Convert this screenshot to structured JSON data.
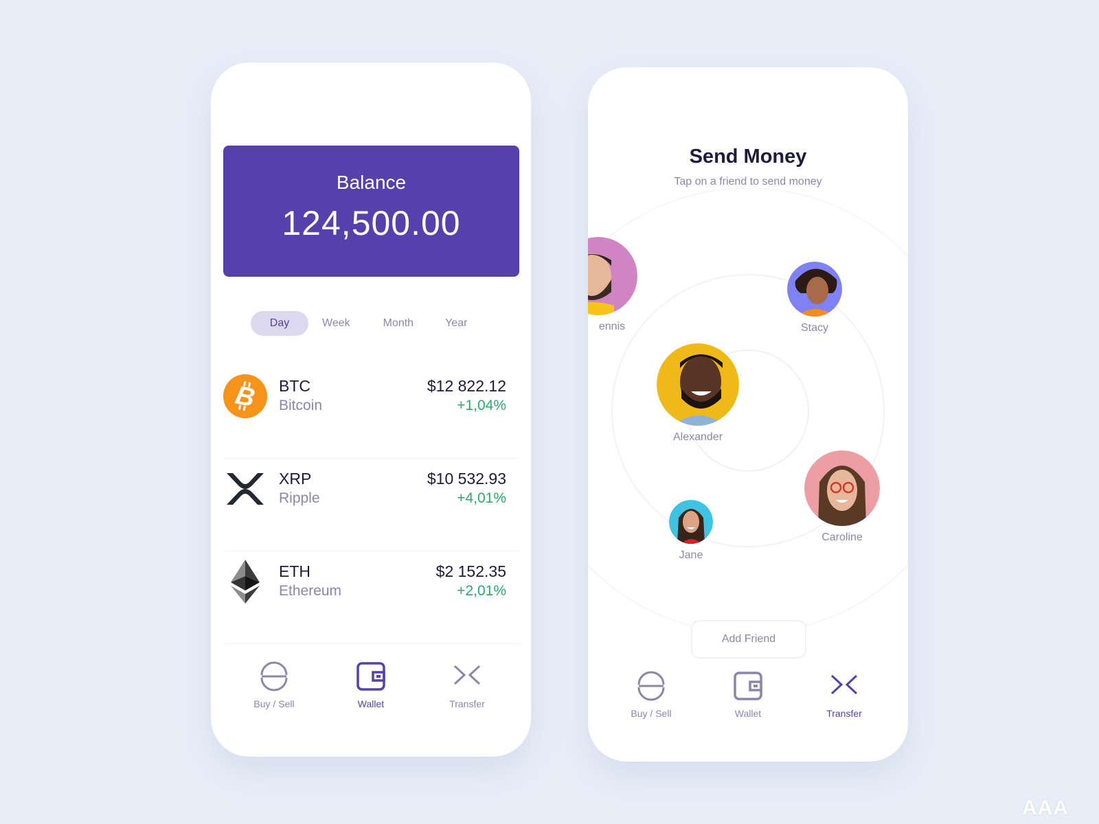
{
  "colors": {
    "background": "#e8eef8",
    "accent": "#5641ac",
    "accent_light": "#dcd9ee",
    "muted_text": "#8b87a8",
    "dark_text": "#1d1b3a",
    "positive": "#2fa86b",
    "btc_orange": "#f7931a"
  },
  "wallet_screen": {
    "balance": {
      "label": "Balance",
      "value": "124,500.00"
    },
    "period_tabs": [
      {
        "label": "Day",
        "active": true
      },
      {
        "label": "Week",
        "active": false
      },
      {
        "label": "Month",
        "active": false
      },
      {
        "label": "Year",
        "active": false
      }
    ],
    "coins": [
      {
        "symbol": "BTC",
        "name": "Bitcoin",
        "price": "$12 822.12",
        "change": "+1,04%",
        "icon": "bitcoin-icon"
      },
      {
        "symbol": "XRP",
        "name": "Ripple",
        "price": "$10 532.93",
        "change": "+4,01%",
        "icon": "ripple-icon"
      },
      {
        "symbol": "ETH",
        "name": "Ethereum",
        "price": "$2 152.35",
        "change": "+2,01%",
        "icon": "ethereum-icon"
      }
    ],
    "nav": [
      {
        "label": "Buy / Sell",
        "icon": "buy-sell-icon",
        "active": false
      },
      {
        "label": "Wallet",
        "icon": "wallet-icon",
        "active": true
      },
      {
        "label": "Transfer",
        "icon": "transfer-icon",
        "active": false
      }
    ]
  },
  "send_screen": {
    "title": "Send Money",
    "subtitle": "Tap on a friend to send money",
    "friends": [
      {
        "name": "ennis",
        "bg": "#d184c4"
      },
      {
        "name": "Stacy",
        "bg": "#7f82f5"
      },
      {
        "name": "Alexander",
        "bg": "#efba19"
      },
      {
        "name": "Caroline",
        "bg": "#ec9ea3"
      },
      {
        "name": "Jane",
        "bg": "#3fc3e3"
      }
    ],
    "add_friend_label": "Add Friend",
    "nav": [
      {
        "label": "Buy / Sell",
        "icon": "buy-sell-icon",
        "active": false
      },
      {
        "label": "Wallet",
        "icon": "wallet-icon",
        "active": false
      },
      {
        "label": "Transfer",
        "icon": "transfer-icon",
        "active": true
      }
    ]
  },
  "watermark": "AAA"
}
